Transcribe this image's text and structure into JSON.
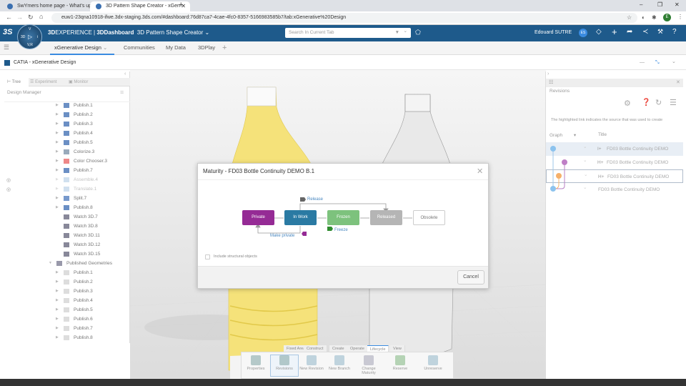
{
  "browser": {
    "tabs": [
      {
        "title": "SwYmers home page - What's up"
      },
      {
        "title": "3D Pattern Shape Creator - xGen"
      }
    ],
    "url": "euw1-23qna10918-ifwe.3dx-staging.3ds.com/#dashboard:76d87ca7-4cae-4fc0-8357-5166983585b7/tab:xGenerative%20Design",
    "profile_initial": "E"
  },
  "topbar": {
    "brand_bold": "3D",
    "brand": "EXPERIENCE | ",
    "dashboard": "3DDashboard",
    "dashboard_name": "3D Pattern Shape Creator",
    "search_placeholder": "Search In Current Tab",
    "user": "Edouard SUTRE",
    "user_initials": "ES",
    "compass": {
      "top": "V",
      "left": "3D",
      "right": "i",
      "bottom": "V,R"
    }
  },
  "dashboard_tabs": [
    "xGenerative Design",
    "Communities",
    "My Data",
    "3DPlay"
  ],
  "app": {
    "title": "CATIA - xGenerative Design"
  },
  "left_panel": {
    "tabs": [
      "Tree",
      "Experiment",
      "Monitor"
    ],
    "header": "Design Manager",
    "items": [
      {
        "label": "Publish.1"
      },
      {
        "label": "Publish.2"
      },
      {
        "label": "Publish.3"
      },
      {
        "label": "Publish.4"
      },
      {
        "label": "Publish.5"
      },
      {
        "label": "Colorize.3"
      },
      {
        "label": "Color Chooser.3"
      },
      {
        "label": "Publish.7"
      },
      {
        "label": "Assemble.4"
      },
      {
        "label": "Translate.1"
      },
      {
        "label": "Split.7"
      },
      {
        "label": "Publish.8"
      },
      {
        "label": "Watch 3D.7"
      },
      {
        "label": "Watch 3D.8"
      },
      {
        "label": "Watch 3D.11"
      },
      {
        "label": "Watch 3D.12"
      },
      {
        "label": "Watch 3D.15"
      },
      {
        "label": "Published Geometries"
      },
      {
        "label": "Publish.1"
      },
      {
        "label": "Publish.2"
      },
      {
        "label": "Publish.3"
      },
      {
        "label": "Publish.4"
      },
      {
        "label": "Publish.5"
      },
      {
        "label": "Publish.6"
      },
      {
        "label": "Publish.7"
      },
      {
        "label": "Publish.8"
      }
    ]
  },
  "right_panel": {
    "title": "Revisions",
    "info": "The highlighted link indicates the source that was used to create",
    "col_graph": "Graph",
    "col_title": "Title",
    "rows": [
      {
        "title": "FD03 Bottle Continuity DEMO"
      },
      {
        "title": "FD03 Bottle Continuity DEMO"
      },
      {
        "title": "FD03 Bottle Continuity DEMO"
      },
      {
        "title": "FD03 Bottle Continuity DEMO"
      }
    ]
  },
  "dialog": {
    "title": "Maturity - FD03 Bottle Continuity DEMO B.1",
    "states": [
      {
        "label": "Private",
        "color": "#952b95"
      },
      {
        "label": "In Work",
        "color": "#2a7aa3"
      },
      {
        "label": "Frozen",
        "color": "#7dc27d"
      },
      {
        "label": "Released",
        "color": "#b5b5b5"
      },
      {
        "label": "Obsolete",
        "color": "#ffffff"
      }
    ],
    "transitions": {
      "release": "Release",
      "freeze": "Freeze",
      "make_private": "Make private"
    },
    "checkbox_label": "Include structural objects",
    "cancel": "Cancel"
  },
  "ribbon": {
    "tabs": [
      "Fixed Area",
      "Construct",
      "Create",
      "Operate",
      "Lifecycle",
      "View"
    ],
    "active_tab": "Lifecycle",
    "buttons": [
      {
        "label": "Properties"
      },
      {
        "label": "Revisions"
      },
      {
        "label": "New Revision"
      },
      {
        "label": "New Branch"
      },
      {
        "label": "Change Maturity"
      },
      {
        "label": "Reserve"
      },
      {
        "label": "Unreserve"
      }
    ]
  }
}
